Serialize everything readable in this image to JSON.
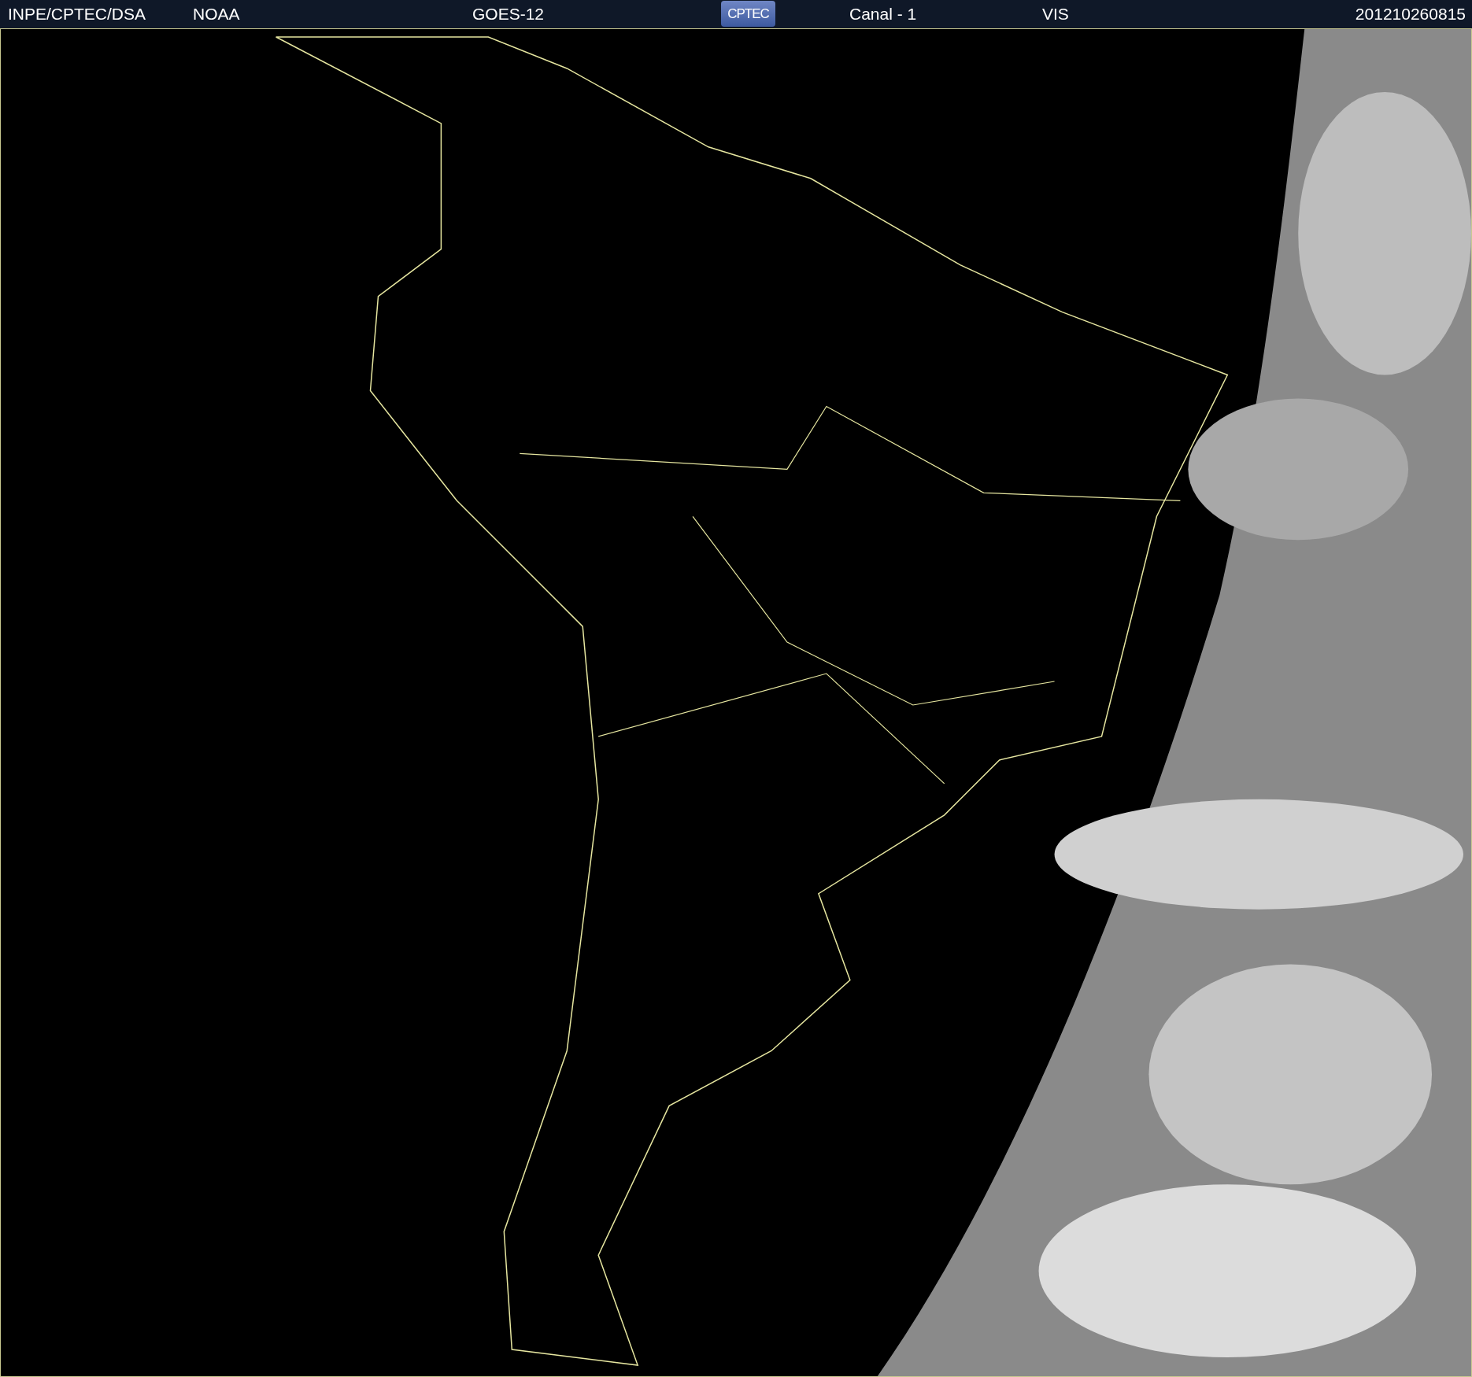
{
  "header": {
    "source": "INPE/CPTEC/DSA",
    "agency": "NOAA",
    "satellite": "GOES-12",
    "logo": "CPTEC",
    "channel": "Canal - 1",
    "band": "VIS",
    "timestamp": "201210260815"
  }
}
